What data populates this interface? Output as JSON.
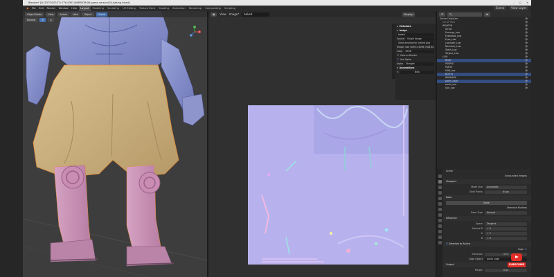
{
  "window": {
    "title": "Blender* [D:\\TUTOS\\TUTO STYLIZED WARRIOR\\06-game-version\\04-baking.blend]",
    "controls": [
      "–",
      "□",
      "✕"
    ]
  },
  "menubar": {
    "menus": [
      "File",
      "Edit",
      "Render",
      "Window",
      "Help"
    ],
    "workspaces": [
      "Layout",
      "Modeling",
      "Sculpting",
      "UV Editing",
      "Texture Paint",
      "Shading",
      "Animation",
      "Rendering",
      "Compositing",
      "Scripting"
    ],
    "active_workspace": "Layout",
    "scene": "Scene",
    "view_layer": "View Layer"
  },
  "viewport": {
    "mode": "Object Mode",
    "view": "View",
    "select": "Select",
    "add": "Add",
    "object": "Object",
    "orientation": "Global",
    "normal": "Normal",
    "gizmo": {
      "x": "X",
      "y": "Y",
      "z": "Z"
    }
  },
  "image_editor": {
    "view": "View",
    "image_menu": "Image*",
    "image_name": "baked",
    "display_mode": "Display",
    "npanel": {
      "metadata_hdr": "Metadata",
      "image_hdr": "Image",
      "image_field": "baked",
      "source_label": "Source",
      "source_value": "Single Image",
      "filepath": "//textures/warrior_baked.png",
      "info": "Image: size 4096 x 4096, RGB Bu",
      "color_label": "Color",
      "color_value": "sRGB",
      "view_as_render": "View as Render",
      "use_alpha": "Use Alpha",
      "alpha_label": "Alpha",
      "alpha_value": "Straight",
      "annotations_hdr": "Annotations",
      "annotations_new": "New"
    }
  },
  "outliner": {
    "search_placeholder": "",
    "rows": [
      {
        "name": "Scene Collection",
        "indent": 0,
        "sel": false,
        "dim": false
      },
      {
        "name": "SCULPTING",
        "indent": 1,
        "sel": false,
        "dim": true
      },
      {
        "name": "WEAPON",
        "indent": 1,
        "sel": false,
        "dim": false
      },
      {
        "name": "Arrow",
        "indent": 2,
        "sel": false,
        "dim": false
      },
      {
        "name": "Earrings_Low",
        "indent": 2,
        "sel": false,
        "dim": false
      },
      {
        "name": "Eyebrows_Low",
        "indent": 2,
        "sel": false,
        "dim": false
      },
      {
        "name": "Eyes_Low",
        "indent": 2,
        "sel": false,
        "dim": false
      },
      {
        "name": "Loincloth_Low",
        "indent": 2,
        "sel": false,
        "dim": false
      },
      {
        "name": "Necklace_Low",
        "indent": 2,
        "sel": false,
        "dim": false
      },
      {
        "name": "Teeth_Low",
        "indent": 2,
        "sel": false,
        "dim": false
      },
      {
        "name": "Tongue_Low",
        "indent": 2,
        "sel": false,
        "dim": false
      },
      {
        "name": "LOW",
        "indent": 1,
        "sel": false,
        "dim": false
      },
      {
        "name": "BODY",
        "indent": 2,
        "sel": true,
        "dim": false
      },
      {
        "name": "PURPLE",
        "indent": 2,
        "sel": false,
        "dim": false
      },
      {
        "name": "PANTS",
        "indent": 2,
        "sel": false,
        "dim": false
      },
      {
        "name": "SKIN_low",
        "indent": 2,
        "sel": false,
        "dim": false
      },
      {
        "name": "BOOTS",
        "indent": 2,
        "sel": true,
        "dim": false
      },
      {
        "name": "BANDANA",
        "indent": 2,
        "sel": false,
        "dim": false
      },
      {
        "name": "pants_cage",
        "indent": 2,
        "sel": true,
        "dim": false
      },
      {
        "name": "pants_low",
        "indent": 2,
        "sel": false,
        "dim": false
      },
      {
        "name": "skin_low",
        "indent": 2,
        "sel": false,
        "dim": false
      }
    ]
  },
  "properties": {
    "header": "Scene",
    "unbounded": "Unbounded Images",
    "viewport_hdr": "Viewport",
    "mode_label": "Mode Size",
    "mode_value": "Automatic",
    "shell_label": "Shell Points",
    "shell_value": "64 px",
    "bake_hdr": "Bake",
    "bake_btn": "Bake",
    "selective_label": "Selective Multires",
    "bake_type_label": "Bake Type",
    "bake_type_value": "Normal",
    "influence_hdr": "Influence",
    "space_label": "Space",
    "space_value": "Tangent",
    "swizzle_label": "Swizzle R",
    "swizzle_r": "+ X",
    "g_label": "G",
    "g_value": "+ Y",
    "b_label": "B",
    "b_value": "+ Z",
    "selected_active_hdr": "Selected to Active",
    "cage_label": "Cage",
    "extrusion_label": "Extrusion",
    "extrusion_value": "0 m",
    "cage_object_label": "Cage Object",
    "cage_object_value": "pants cage",
    "output_hdr": "Output",
    "margin_label": "Margin",
    "margin_value": "0 px"
  },
  "overlay": {
    "subscribe": "SUBSCRIBE"
  }
}
